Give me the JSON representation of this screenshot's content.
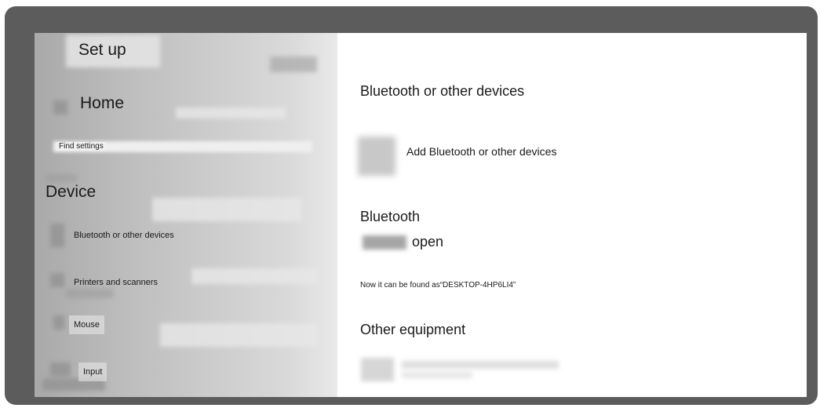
{
  "sidebar": {
    "title": "Set up",
    "home": "Home",
    "search_placeholder": "Find settings",
    "section": "Device",
    "items": [
      {
        "label": "Bluetooth or other devices"
      },
      {
        "label": "Printers and scanners"
      },
      {
        "label": "Mouse"
      },
      {
        "label": "Input"
      }
    ]
  },
  "main": {
    "heading": "Bluetooth or other devices",
    "add_device": "Add Bluetooth or other devices",
    "bluetooth_heading": "Bluetooth",
    "bluetooth_state": "open",
    "discoverable_text": "Now it can be found as“DESKTOP-4HP6LI4”",
    "other_heading": "Other equipment"
  },
  "icons": {
    "home": "home-icon",
    "add_device": "add-device-icon",
    "bluetooth_item": "bluetooth-icon",
    "printers_item": "printer-icon",
    "mouse_item": "mouse-icon",
    "input_item": "keyboard-icon",
    "other_device": "device-icon"
  }
}
